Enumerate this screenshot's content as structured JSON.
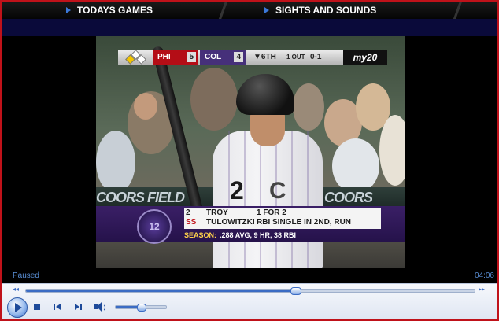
{
  "nav": {
    "tabs": [
      {
        "label": "TODAYS GAMES"
      },
      {
        "label": "SIGHTS AND SOUNDS"
      }
    ]
  },
  "video": {
    "scorebug": {
      "away_team": "PHI",
      "away_score": "5",
      "home_team": "COL",
      "home_score": "4",
      "inning": "▼6TH",
      "outs": "1 OUT",
      "count": "0-1",
      "network": "my20"
    },
    "stadium_banner": [
      "COORS FIELD",
      "COORS FIELD"
    ],
    "jersey_number": "2",
    "jersey_logo": "C",
    "lower_third": {
      "logo_text": "12",
      "player_number": "2",
      "position": "SS",
      "first_name": "TROY",
      "last_name": "TULOWITZKI",
      "stat_line_1": "1 FOR 2",
      "stat_line_2": "RBI SINGLE IN 2ND, RUN",
      "season_label": "SEASON:",
      "season_stats": ".288 AVG, 9 HR, 38 RBI"
    }
  },
  "player": {
    "status": "Paused",
    "time": "04:06",
    "progress_fraction": 0.6,
    "volume_fraction": 0.5,
    "colors": {
      "accent": "#3b6cc4",
      "status_text": "#5a8fd6",
      "frame_border": "#c0121a"
    }
  },
  "icons": [
    "play-icon",
    "stop-icon",
    "previous-icon",
    "next-icon",
    "volume-icon",
    "seek-back-icon",
    "seek-forward-icon"
  ]
}
